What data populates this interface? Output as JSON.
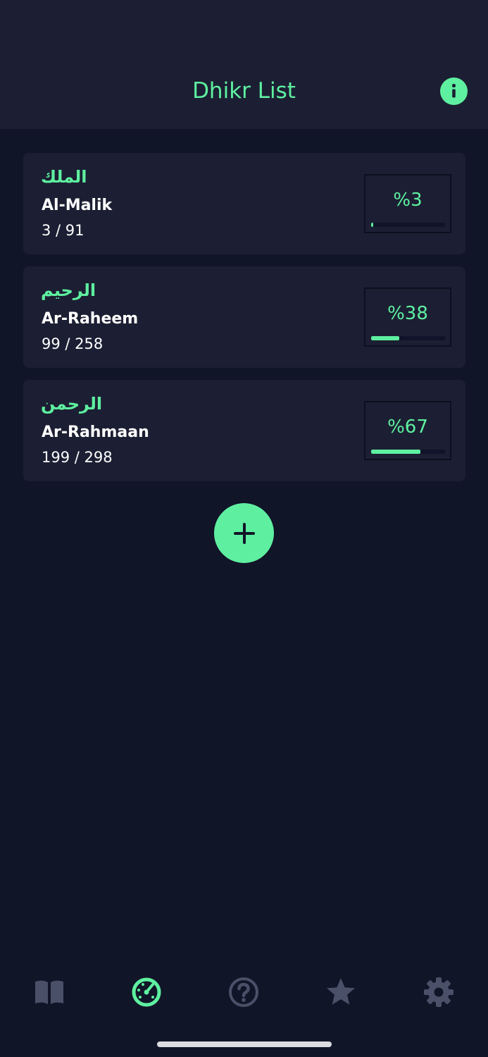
{
  "header": {
    "title": "Dhikr List",
    "info_icon": "info-icon"
  },
  "colors": {
    "accent": "#5ef0a0",
    "background": "#111528",
    "card": "#1c1f33",
    "nav_inactive": "#4a5068"
  },
  "dhikr_list": [
    {
      "arabic": "الملك",
      "name": "Al-Malik",
      "count": "3 / 91",
      "percent_label": "%3",
      "progress": 0.03
    },
    {
      "arabic": "الرحيم",
      "name": "Ar-Raheem",
      "count": "99 / 258",
      "percent_label": "%38",
      "progress": 0.38
    },
    {
      "arabic": "الرحمن",
      "name": "Ar-Rahmaan",
      "count": "199 / 298",
      "percent_label": "%67",
      "progress": 0.67
    }
  ],
  "add_button": {
    "icon": "plus-icon"
  },
  "nav": {
    "items": [
      {
        "icon": "book-icon",
        "active": false
      },
      {
        "icon": "gauge-icon",
        "active": true
      },
      {
        "icon": "question-icon",
        "active": false
      },
      {
        "icon": "star-icon",
        "active": false
      },
      {
        "icon": "gear-icon",
        "active": false
      }
    ]
  }
}
